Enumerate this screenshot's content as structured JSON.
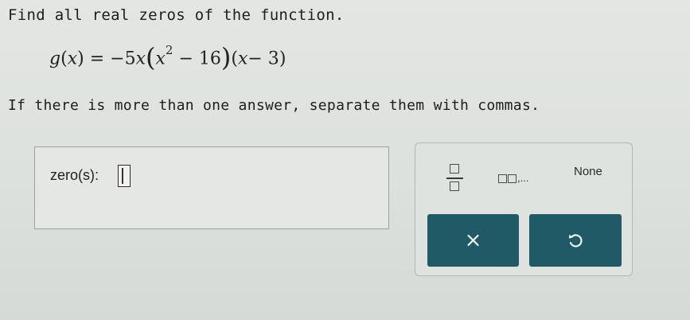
{
  "question": {
    "prompt": "Find all real zeros of the function.",
    "equation": {
      "lhs_fn": "g",
      "lhs_var": "x",
      "equals": "=",
      "coef": "−5",
      "var1": "x",
      "factor2_var": "x",
      "exponent": "2",
      "factor2_rest": "− 16",
      "factor3_var": "x",
      "factor3_rest": "− 3"
    },
    "instruction": "If there is more than one answer, separate them with commas."
  },
  "answer": {
    "label": "zero(s):",
    "value": ""
  },
  "keypad": {
    "list_suffix": ",...",
    "none_label": "None",
    "clear_symbol": "×",
    "icons": {
      "fraction": "fraction-icon",
      "list": "list-icon",
      "undo": "undo-icon",
      "clear": "close-icon"
    },
    "colors": {
      "action_button": "#1f5a66"
    }
  }
}
